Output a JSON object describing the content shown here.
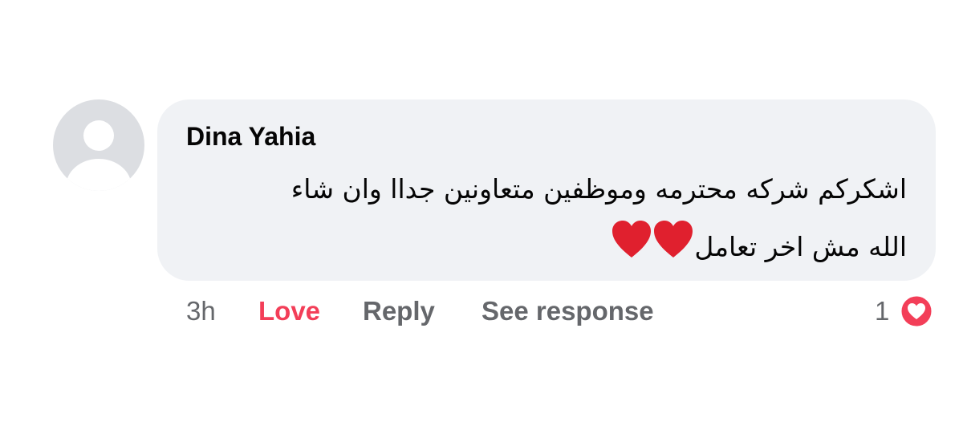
{
  "comment": {
    "author": "Dina Yahia",
    "text_line1": "اشكركم شركه محترمه وموظفين متعاونين جداا وان شاء",
    "text_line2": "الله مش اخر تعامل",
    "emoji": "❤❤"
  },
  "actions": {
    "time": "3h",
    "love_label": "Love",
    "reply_label": "Reply",
    "see_response_label": "See response"
  },
  "reactions": {
    "count": "1",
    "icon": "love-reaction-icon"
  },
  "colors": {
    "love": "#f33e58",
    "bubble": "#f0f2f5",
    "secondary_text": "#65676b",
    "avatar_bg": "#dcdee2",
    "heart": "#e0202e"
  }
}
